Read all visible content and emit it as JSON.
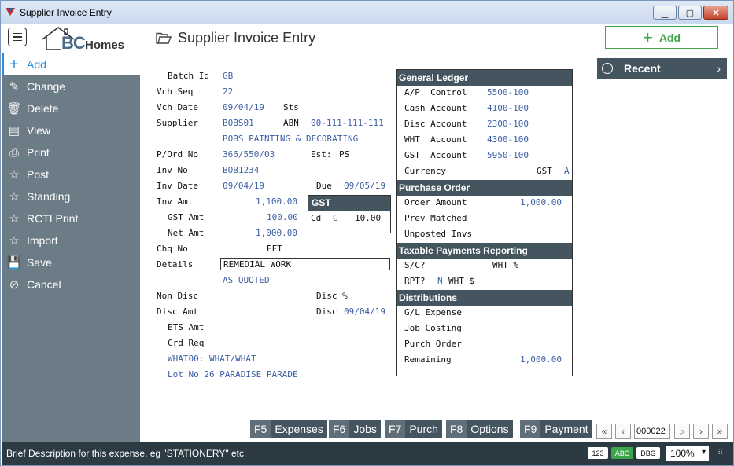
{
  "window": {
    "title": "Supplier Invoice Entry"
  },
  "header": {
    "page_title": "Supplier Invoice Entry",
    "add_label": "Add",
    "logo_bc": "BC",
    "logo_homes": "Homes"
  },
  "sidebar": {
    "items": [
      {
        "label": "Add",
        "icon": "plus-icon"
      },
      {
        "label": "Change",
        "icon": "edit-icon"
      },
      {
        "label": "Delete",
        "icon": "trash-icon"
      },
      {
        "label": "View",
        "icon": "table-icon"
      },
      {
        "label": "Print",
        "icon": "printer-icon"
      },
      {
        "label": "Post",
        "icon": "star-icon"
      },
      {
        "label": "Standing",
        "icon": "star-icon"
      },
      {
        "label": "RCTI Print",
        "icon": "star-icon"
      },
      {
        "label": "Import",
        "icon": "star-icon"
      },
      {
        "label": "Save",
        "icon": "save-icon"
      },
      {
        "label": "Cancel",
        "icon": "cancel-icon"
      }
    ]
  },
  "form": {
    "batch_id_label": "Batch Id",
    "batch_id": "GB",
    "vch_seq_label": "Vch Seq",
    "vch_seq": "22",
    "vch_date_label": "Vch Date",
    "vch_date": "09/04/19",
    "sts_label": "Sts",
    "supplier_label": "Supplier",
    "supplier": "BOBS01",
    "abn_label": "ABN",
    "abn": "00-111-111-111",
    "supplier_name": "BOBS PAINTING & DECORATING",
    "pord_label": "P/Ord No",
    "pord": "366/550/03",
    "est_label": "Est:",
    "est": "PS",
    "inv_no_label": "Inv No",
    "inv_no": "BOB1234",
    "inv_date_label": "Inv Date",
    "inv_date": "09/04/19",
    "due_label": "Due",
    "due": "09/05/19",
    "inv_amt_label": "Inv Amt",
    "inv_amt": "1,100.00",
    "gst_amt_label": "GST Amt",
    "gst_amt": "100.00",
    "net_amt_label": "Net Amt",
    "net_amt": "1,000.00",
    "chq_no_label": "Chq No",
    "chq_no": "EFT",
    "details_label": "Details",
    "details": "REMEDIAL WORK",
    "details2": "AS QUOTED",
    "non_disc_label": "Non Disc",
    "disc_pct_label": "Disc %",
    "disc_amt_label": "Disc Amt",
    "disc_label": "Disc",
    "disc_date": "09/04/19",
    "ets_amt_label": "ETS Amt",
    "crd_req_label": "Crd Req",
    "what_line": "WHAT00: WHAT/WHAT",
    "lot_line": "Lot No 26 PARADISE PARADE"
  },
  "gst_box": {
    "title": "GST",
    "cd_label": "Cd",
    "cd": "G",
    "amount": "10.00"
  },
  "general_ledger": {
    "title": "General Ledger",
    "rows": [
      {
        "label": "A/P  Control",
        "value": "5500-100"
      },
      {
        "label": "Cash Account",
        "value": "4100-100"
      },
      {
        "label": "Disc Account",
        "value": "2300-100"
      },
      {
        "label": "WHT  Account",
        "value": "4300-100"
      },
      {
        "label": "GST  Account",
        "value": "5950-100"
      }
    ],
    "currency_label": "Currency",
    "currency_code": "GST",
    "currency_value": "A"
  },
  "purchase_order": {
    "title": "Purchase Order",
    "order_amount_label": "Order Amount",
    "order_amount": "1,000.00",
    "prev_matched_label": "Prev Matched",
    "unposted_label": "Unposted Invs"
  },
  "taxable": {
    "title": "Taxable Payments Reporting",
    "sc_label": "S/C?",
    "wht_pct_label": "WHT %",
    "rpt_label": "RPT?",
    "rpt": "N",
    "wht_label": "WHT $"
  },
  "distributions": {
    "title": "Distributions",
    "gl_expense_label": "G/L Expense",
    "job_costing_label": "Job Costing",
    "purch_order_label": "Purch Order",
    "remaining_label": "Remaining",
    "remaining": "1,000.00"
  },
  "recent": {
    "label": "Recent"
  },
  "fkeys": [
    {
      "key": "F5",
      "label": "Expenses"
    },
    {
      "key": "F6",
      "label": "Jobs"
    },
    {
      "key": "F7",
      "label": "Purch"
    },
    {
      "key": "F8",
      "label": "Options"
    },
    {
      "key": "F9",
      "label": "Payment"
    }
  ],
  "pager": {
    "record": "000022"
  },
  "status": {
    "message": "Brief Description for this expense, eg \"STATIONERY\" etc",
    "tag_123": "123",
    "tag_abc": "ABC",
    "tag_dbg": "DBG",
    "zoom": "100%"
  }
}
